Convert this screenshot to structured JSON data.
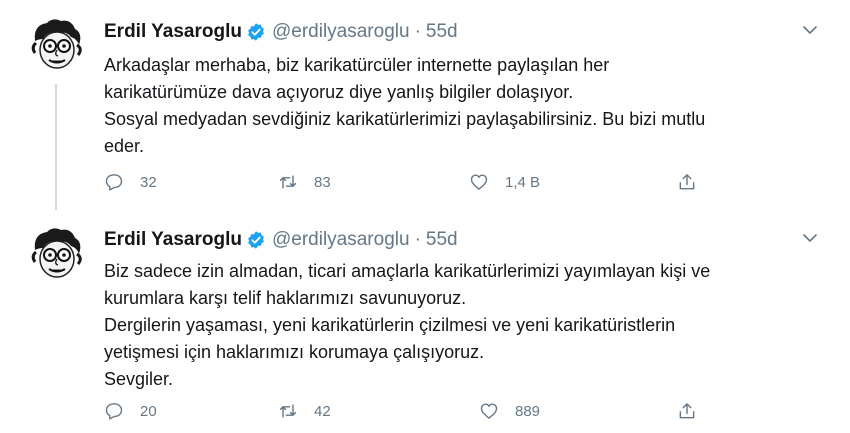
{
  "tweets": [
    {
      "author_name": "Erdil Yasaroglu",
      "handle": "@erdilyasaroglu",
      "separator": "·",
      "time": "55d",
      "lines": [
        "Arkadaşlar merhaba, biz karikatürcüler internette paylaşılan her",
        "karikatürümüze dava açıyoruz diye yanlış bilgiler dolaşıyor.",
        "Sosyal medyadan sevdiğiniz karikatürlerimizi paylaşabilirsiniz. Bu bizi mutlu",
        "eder."
      ],
      "replies": "32",
      "retweets": "83",
      "likes": "1,4 B"
    },
    {
      "author_name": "Erdil Yasaroglu",
      "handle": "@erdilyasaroglu",
      "separator": "·",
      "time": "55d",
      "lines": [
        "Biz sadece izin almadan, ticari amaçlarla karikatürlerimizi yayımlayan kişi ve",
        "kurumlara karşı telif haklarımızı savunuyoruz.",
        "Dergilerin yaşaması, yeni karikatürlerin çizilmesi ve yeni karikatüristlerin",
        "yetişmesi için haklarımızı korumaya çalışıyoruz.",
        "Sevgiler."
      ],
      "replies": "20",
      "retweets": "42",
      "likes": "889"
    }
  ],
  "icons": {
    "verified": "verified-badge-icon",
    "more": "chevron-down-icon",
    "reply": "reply-icon",
    "retweet": "retweet-icon",
    "like": "heart-icon",
    "share": "share-icon"
  },
  "colors": {
    "verified": "#1da1f2",
    "muted": "#657786",
    "text": "#14171a",
    "thread_line": "#cfd9de"
  }
}
